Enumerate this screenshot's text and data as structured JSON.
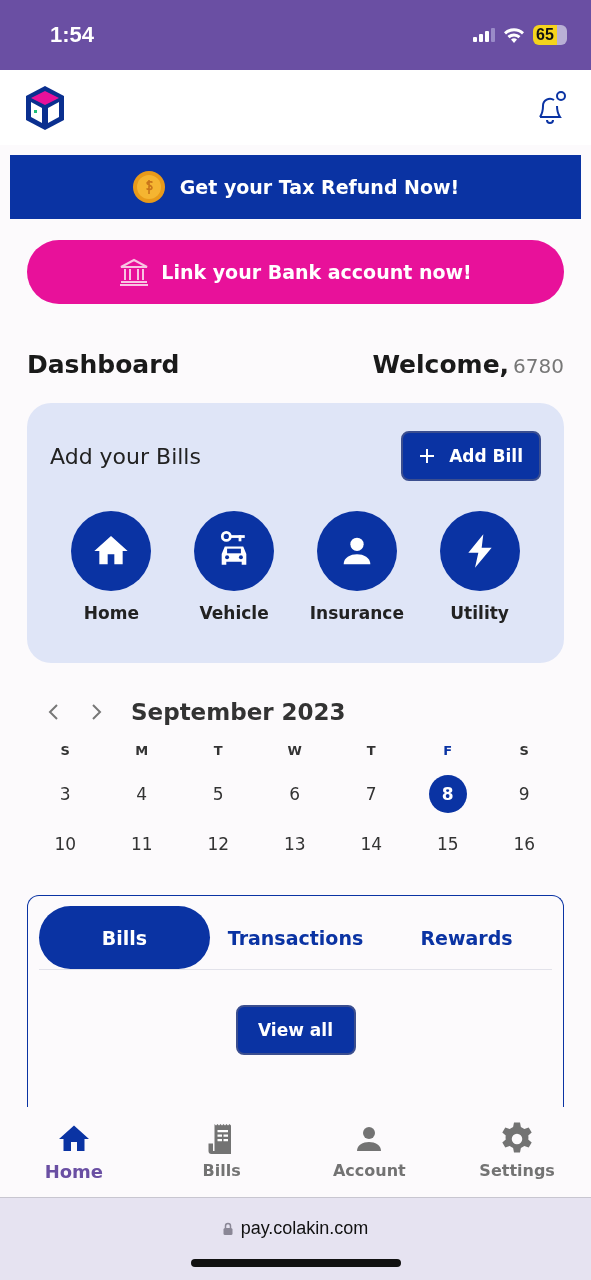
{
  "status_bar": {
    "time": "1:54",
    "battery": "65"
  },
  "promo_banner": {
    "label": "Get your Tax Refund Now!"
  },
  "link_bank_button": {
    "label": "Link your Bank account now!"
  },
  "dashboard": {
    "title": "Dashboard",
    "welcome": "Welcome,",
    "user_id": "6780"
  },
  "bills_card": {
    "title": "Add your Bills",
    "add_button": "Add Bill",
    "categories": [
      {
        "kind": "home",
        "label": "Home"
      },
      {
        "kind": "vehicle",
        "label": "Vehicle"
      },
      {
        "kind": "insurance",
        "label": "Insurance"
      },
      {
        "kind": "utility",
        "label": "Utility"
      }
    ]
  },
  "calendar": {
    "month": "September 2023",
    "weekdays": [
      {
        "label": "S",
        "selected": false
      },
      {
        "label": "M",
        "selected": false
      },
      {
        "label": "T",
        "selected": false
      },
      {
        "label": "W",
        "selected": false
      },
      {
        "label": "T",
        "selected": false
      },
      {
        "label": "F",
        "selected": true
      },
      {
        "label": "S",
        "selected": false
      }
    ],
    "weeks": [
      [
        {
          "day": "3",
          "selected": false
        },
        {
          "day": "4",
          "selected": false
        },
        {
          "day": "5",
          "selected": false
        },
        {
          "day": "6",
          "selected": false
        },
        {
          "day": "7",
          "selected": false
        },
        {
          "day": "8",
          "selected": true
        },
        {
          "day": "9",
          "selected": false
        }
      ],
      [
        {
          "day": "10",
          "selected": false
        },
        {
          "day": "11",
          "selected": false
        },
        {
          "day": "12",
          "selected": false
        },
        {
          "day": "13",
          "selected": false
        },
        {
          "day": "14",
          "selected": false
        },
        {
          "day": "15",
          "selected": false
        },
        {
          "day": "16",
          "selected": false
        }
      ]
    ]
  },
  "tabs": [
    {
      "label": "Bills",
      "selected": true
    },
    {
      "label": "Transactions",
      "selected": false
    },
    {
      "label": "Rewards",
      "selected": false
    }
  ],
  "view_all_button": "View all",
  "bottom_nav": [
    {
      "kind": "home",
      "label": "Home",
      "selected": true
    },
    {
      "kind": "bills",
      "label": "Bills",
      "selected": false
    },
    {
      "kind": "account",
      "label": "Account",
      "selected": false
    },
    {
      "kind": "settings",
      "label": "Settings",
      "selected": false
    }
  ],
  "browser_bar": {
    "url": "pay.colakin.com"
  }
}
